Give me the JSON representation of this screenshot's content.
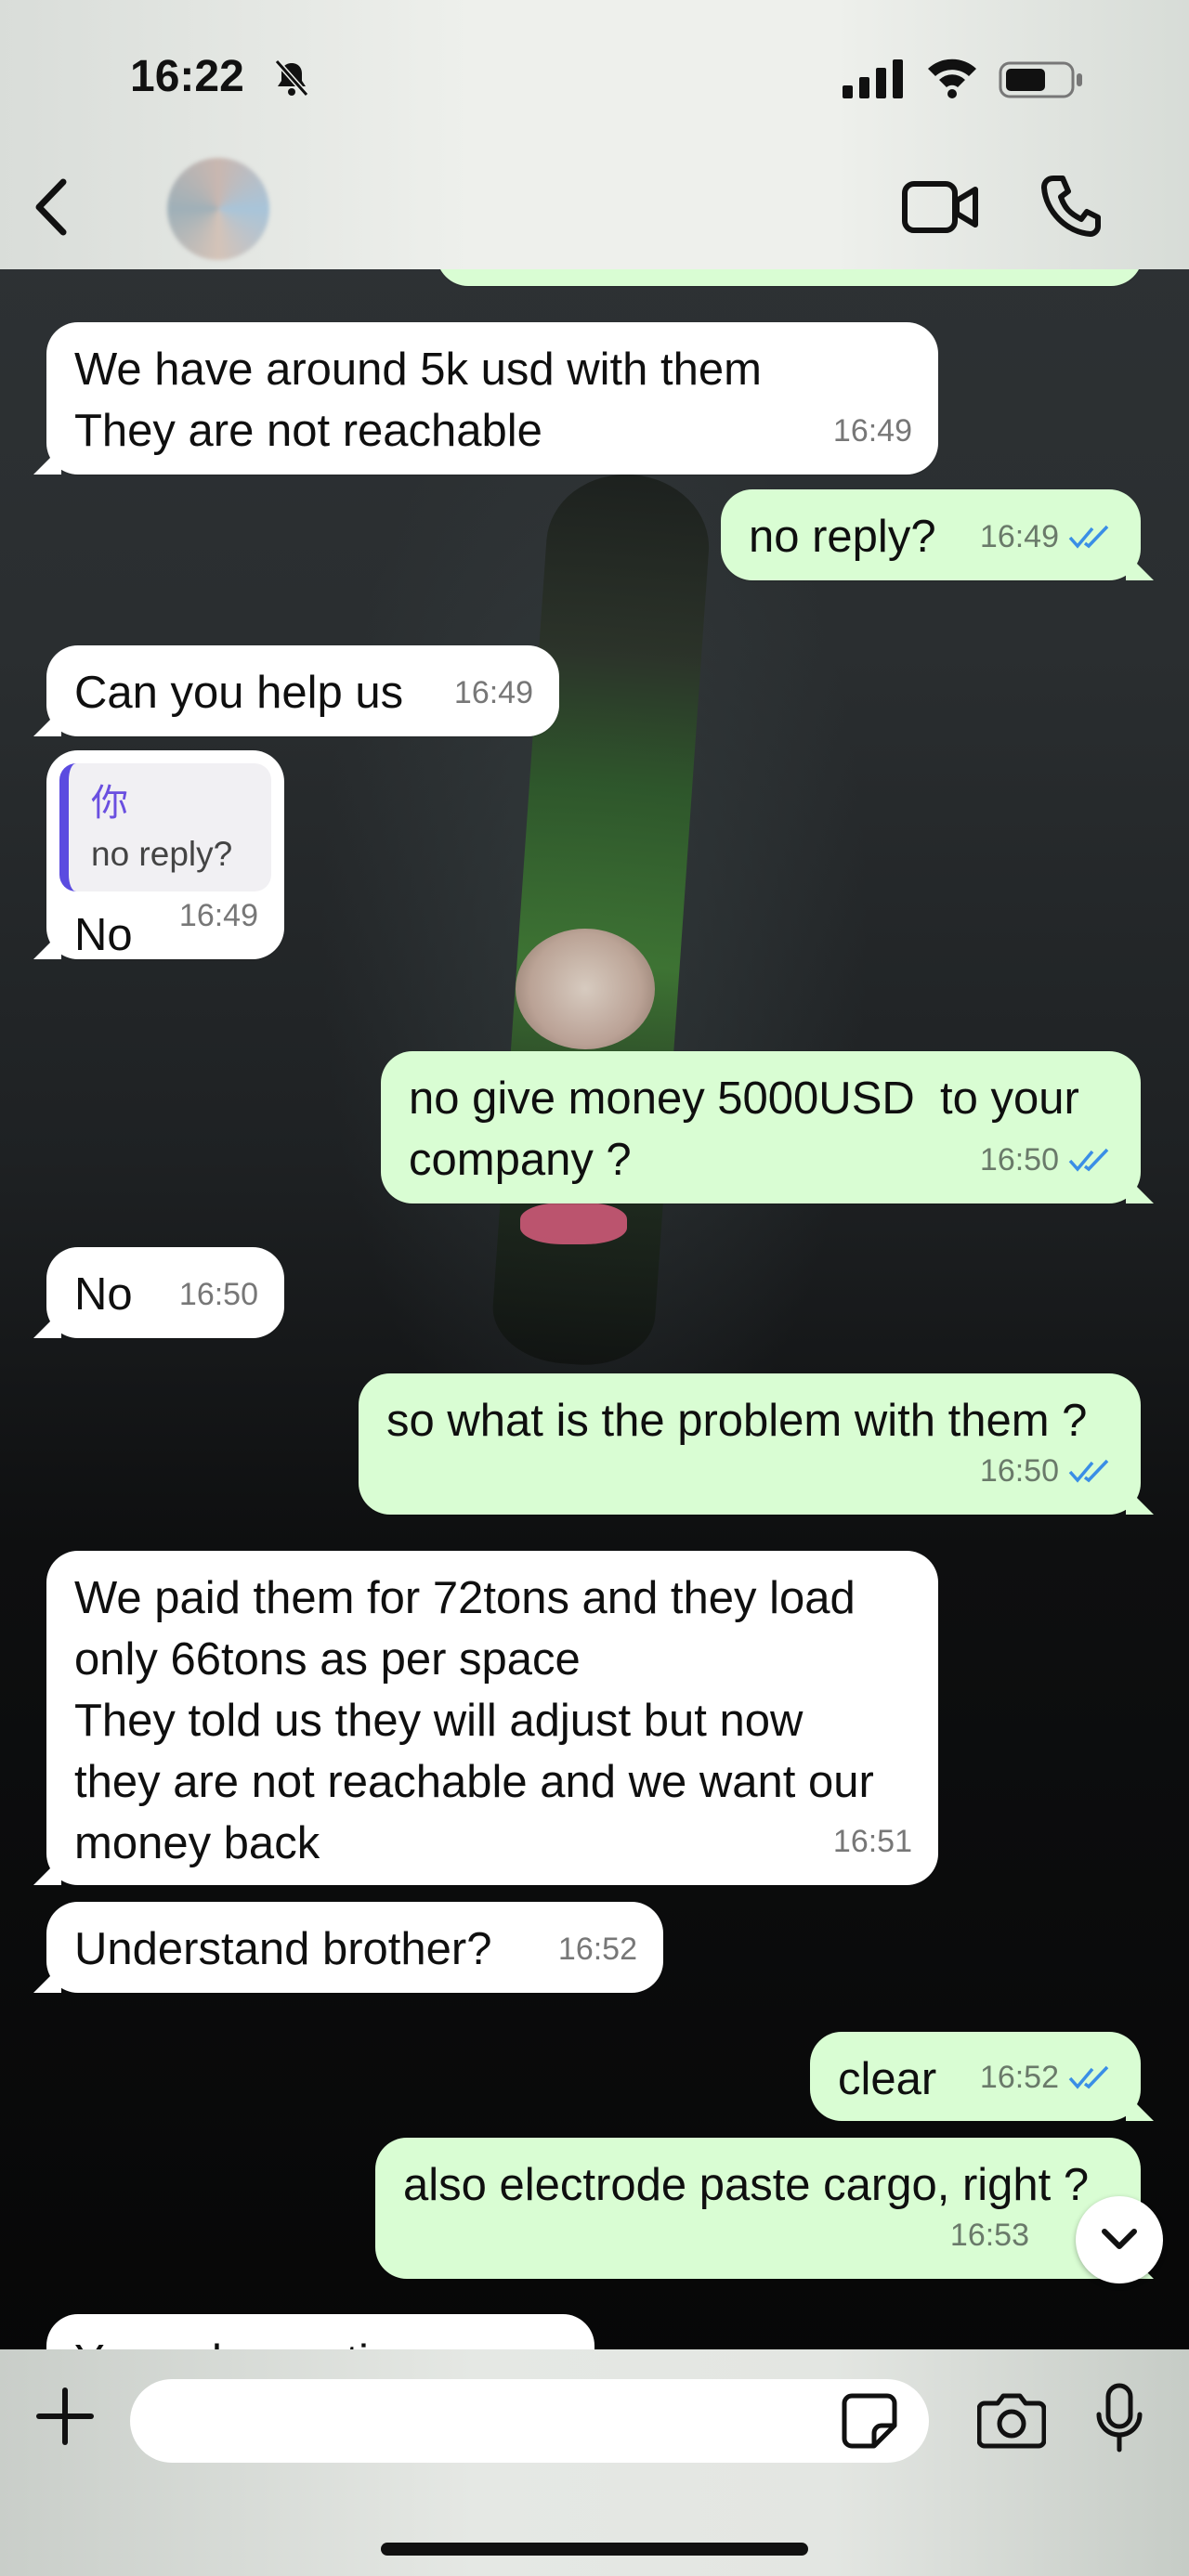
{
  "status_bar": {
    "time": "16:22"
  },
  "header": {
    "contact_name": ""
  },
  "messages": [
    {
      "dir": "in",
      "text": "We have around 5k usd with them\nThey are not reachable",
      "time": "16:49"
    },
    {
      "dir": "out",
      "text": "no reply?",
      "time": "16:49"
    },
    {
      "dir": "in",
      "text": "Can you help us",
      "time": "16:49"
    },
    {
      "dir": "in",
      "quote_author": "你",
      "quote_text": "no reply?",
      "text": "No",
      "time": "16:49"
    },
    {
      "dir": "out",
      "text": "no give money 5000USD  to your\ncompany ?",
      "time": "16:50"
    },
    {
      "dir": "in",
      "text": "No",
      "time": "16:50"
    },
    {
      "dir": "out",
      "text": "so what is the problem with them ?",
      "time": "16:50"
    },
    {
      "dir": "in",
      "text": "We paid them for 72tons and they load\nonly 66tons as per space\nThey told us they will adjust but now\nthey are not reachable and we want our\nmoney back",
      "time": "16:51"
    },
    {
      "dir": "in",
      "text": "Understand brother?",
      "time": "16:52"
    },
    {
      "dir": "out",
      "text": "clear",
      "time": "16:52"
    },
    {
      "dir": "out",
      "text": "also electrode paste cargo, right ?",
      "time": "16:53"
    },
    {
      "dir": "in",
      "text": "Yes only one time",
      "time": ""
    }
  ],
  "composer": {
    "placeholder": ""
  },
  "colors": {
    "incoming": "#ffffff",
    "outgoing": "#d9fdd3",
    "read_ticks": "#3a8ee6",
    "quote_accent": "#5b4be0"
  }
}
